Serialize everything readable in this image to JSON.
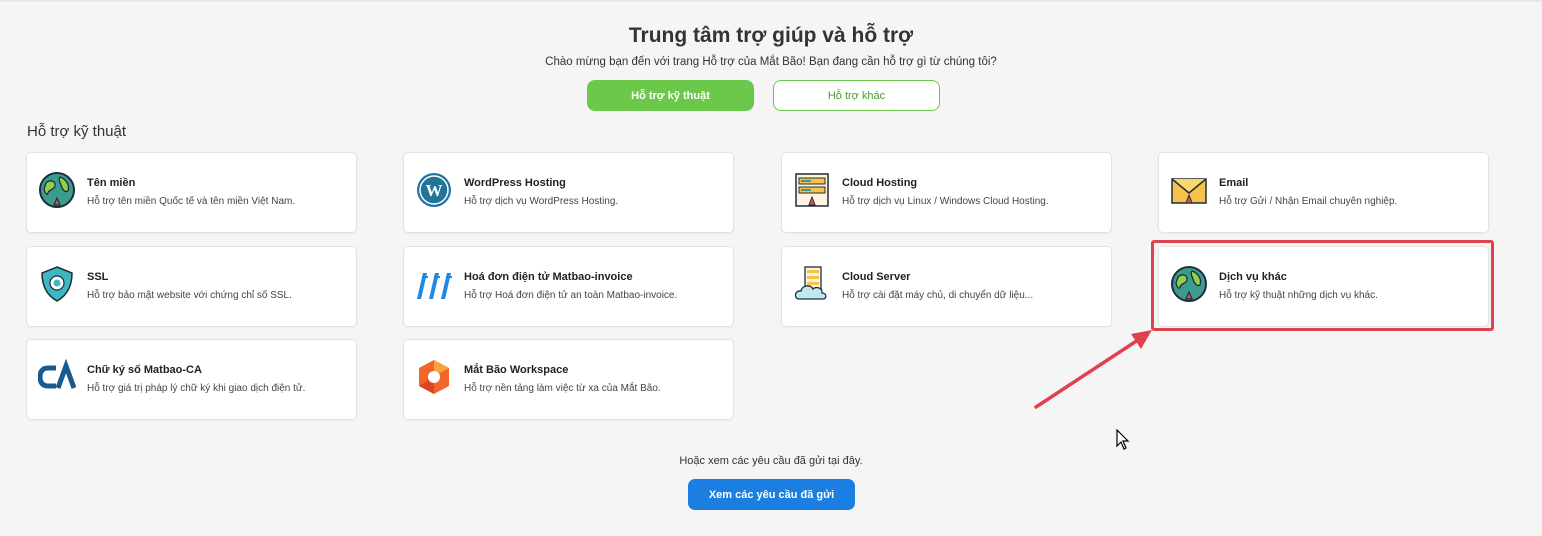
{
  "header": {
    "title": "Trung tâm trợ giúp và hỗ trợ",
    "subtitle": "Chào mừng bạn đến với trang Hỗ trợ của Mắt Bão! Bạn đang cần hỗ trợ gì từ chúng tôi?"
  },
  "tabs": [
    {
      "label": "Hỗ trợ kỹ thuật",
      "active": true
    },
    {
      "label": "Hỗ trợ khác",
      "active": false
    }
  ],
  "section": {
    "title": "Hỗ trợ kỹ thuật"
  },
  "cards": [
    {
      "name": "Tên miền",
      "desc": "Hỗ trợ tên miền Quốc tế và tên miền Việt Nam.",
      "icon": "globe-icon"
    },
    {
      "name": "WordPress Hosting",
      "desc": "Hỗ trợ dịch vụ WordPress Hosting.",
      "icon": "wordpress-icon"
    },
    {
      "name": "Cloud Hosting",
      "desc": "Hỗ trợ dịch vụ Linux / Windows Cloud Hosting.",
      "icon": "server-icon"
    },
    {
      "name": "Email",
      "desc": "Hỗ trợ Gửi / Nhận Email chuyên nghiệp.",
      "icon": "envelope-icon"
    },
    {
      "name": "SSL",
      "desc": "Hỗ trợ bảo mật website với chứng chỉ số SSL.",
      "icon": "shield-icon"
    },
    {
      "name": "Hoá đơn điện tử Matbao-invoice",
      "desc": "Hỗ trợ Hoá đơn điện tử an toàn Matbao-invoice.",
      "icon": "invoice-logo-icon"
    },
    {
      "name": "Cloud Server",
      "desc": "Hỗ trợ cài đặt máy chủ, di chuyển dữ liệu...",
      "icon": "cloud-server-icon"
    },
    {
      "name": "Dịch vụ khác",
      "desc": "Hỗ trợ kỹ thuật những dịch vụ khác.",
      "icon": "globe-icon"
    },
    {
      "name": "Chữ ký số Matbao-CA",
      "desc": "Hỗ trợ giá trị pháp lý chữ ký khi giao dịch điện tử.",
      "icon": "ca-logo-icon"
    },
    {
      "name": "Mắt Bão Workspace",
      "desc": "Hỗ trợ nền tảng làm việc từ xa của Mắt Bão.",
      "icon": "workspace-logo-icon"
    }
  ],
  "footer": {
    "text": "Hoặc xem các yêu cầu đã gửi tại đây.",
    "button_label": "Xem các yêu cầu đã gửi"
  },
  "colors": {
    "primary_green": "#6cc84a",
    "primary_blue": "#1a7fe0",
    "highlight_red": "#e0424d"
  }
}
